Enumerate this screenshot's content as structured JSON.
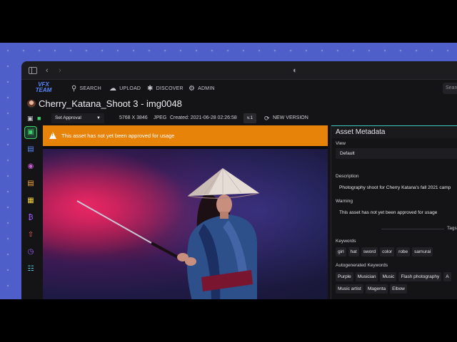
{
  "app": {
    "logo_text": "VFX TEAM",
    "nav": [
      {
        "label": "SEARCH",
        "icon": "search-icon"
      },
      {
        "label": "UPLOAD",
        "icon": "cloud-upload-icon"
      },
      {
        "label": "DISCOVER",
        "icon": "discover-icon"
      },
      {
        "label": "ADMIN",
        "icon": "gears-icon"
      }
    ],
    "search_placeholder": "Searc"
  },
  "asset": {
    "title": "Cherry_Katana_Shoot 3 - img0048",
    "approval_select": "Set Approval",
    "dimensions": "5768 X 3846",
    "format": "JPEG",
    "created": "Created: 2021-06-28 02:26:58",
    "version": "v.1",
    "new_version_label": "NEW VERSION"
  },
  "banner": {
    "warning_text": "This asset has not yet been approved for usage",
    "color": "#e8830a"
  },
  "panel": {
    "heading": "Asset Metadata",
    "view_label": "View",
    "view_value": "Default",
    "description_label": "Description",
    "description_value": "Photography shoot for Cherry Katana's fall 2021 camp",
    "warning_label": "Warning",
    "warning_value": "This asset has not yet been approved for usage",
    "tags_label": "Tags",
    "keywords_label": "Keywords",
    "keywords": [
      "girl",
      "hat",
      "sword",
      "color",
      "robe",
      "samurai"
    ],
    "auto_keywords_label": "Autogenerated Keywords",
    "auto_keywords_row1": [
      "Purple",
      "Musician",
      "Music",
      "Flash photography",
      "A"
    ],
    "auto_keywords_row2": [
      "Music artist",
      "Magenta",
      "Elbow"
    ]
  },
  "rail_icons": [
    "image-icon",
    "comment-icon",
    "masks-icon",
    "chart-icon",
    "gallery-icon",
    "bitcoin-icon",
    "share-icon",
    "clock-icon",
    "hierarchy-icon"
  ],
  "colors": {
    "accent_green": "#3bd16f",
    "accent_teal": "#3ec6c1",
    "background": "#4e5fc9"
  }
}
